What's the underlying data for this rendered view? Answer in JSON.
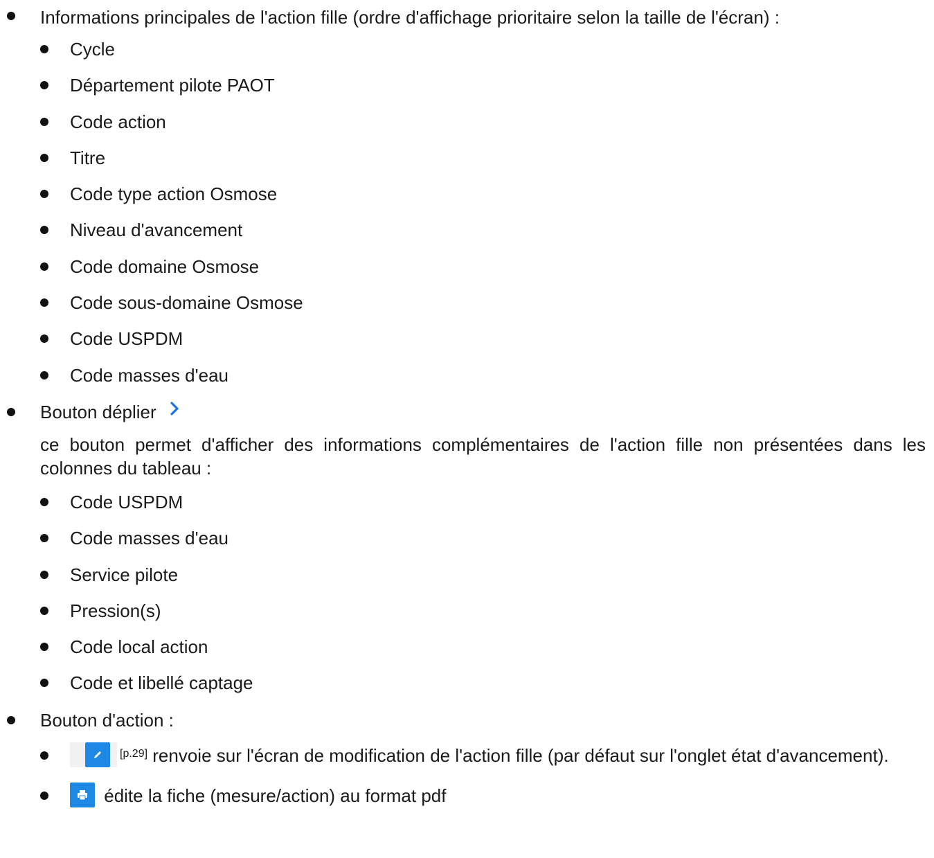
{
  "sections": {
    "main_info": {
      "label": "Informations principales de l'action fille (ordre d'affichage prioritaire selon la taille de l'écran) :",
      "items": [
        "Cycle",
        "Département pilote PAOT",
        "Code action",
        "Titre",
        "Code type action Osmose",
        "Niveau d'avancement",
        "Code domaine Osmose",
        "Code sous-domaine Osmose",
        "Code USPDM",
        "Code masses d'eau"
      ]
    },
    "expand_button": {
      "label": "Bouton déplier",
      "icon": "chevron-right-icon",
      "description": "ce bouton permet d'afficher des informations complémentaires de l'action fille non présentées dans les colonnes du tableau :",
      "items": [
        "Code USPDM",
        "Code masses d'eau",
        "Service pilote",
        "Pression(s)",
        "Code local action",
        "Code et libellé captage"
      ]
    },
    "action_button": {
      "label": "Bouton d'action :",
      "items": [
        {
          "icon": "edit-pencil-icon",
          "ref": "[p.29]",
          "text": "renvoie sur l'écran de modification de l'action fille (par défaut sur l'onglet état d'avancement)."
        },
        {
          "icon": "print-icon",
          "text": "édite la fiche (mesure/action) au format pdf"
        }
      ]
    }
  },
  "colors": {
    "accent": "#1e88e5",
    "chevron": "#1a73e8",
    "text": "#1a1a1a"
  }
}
